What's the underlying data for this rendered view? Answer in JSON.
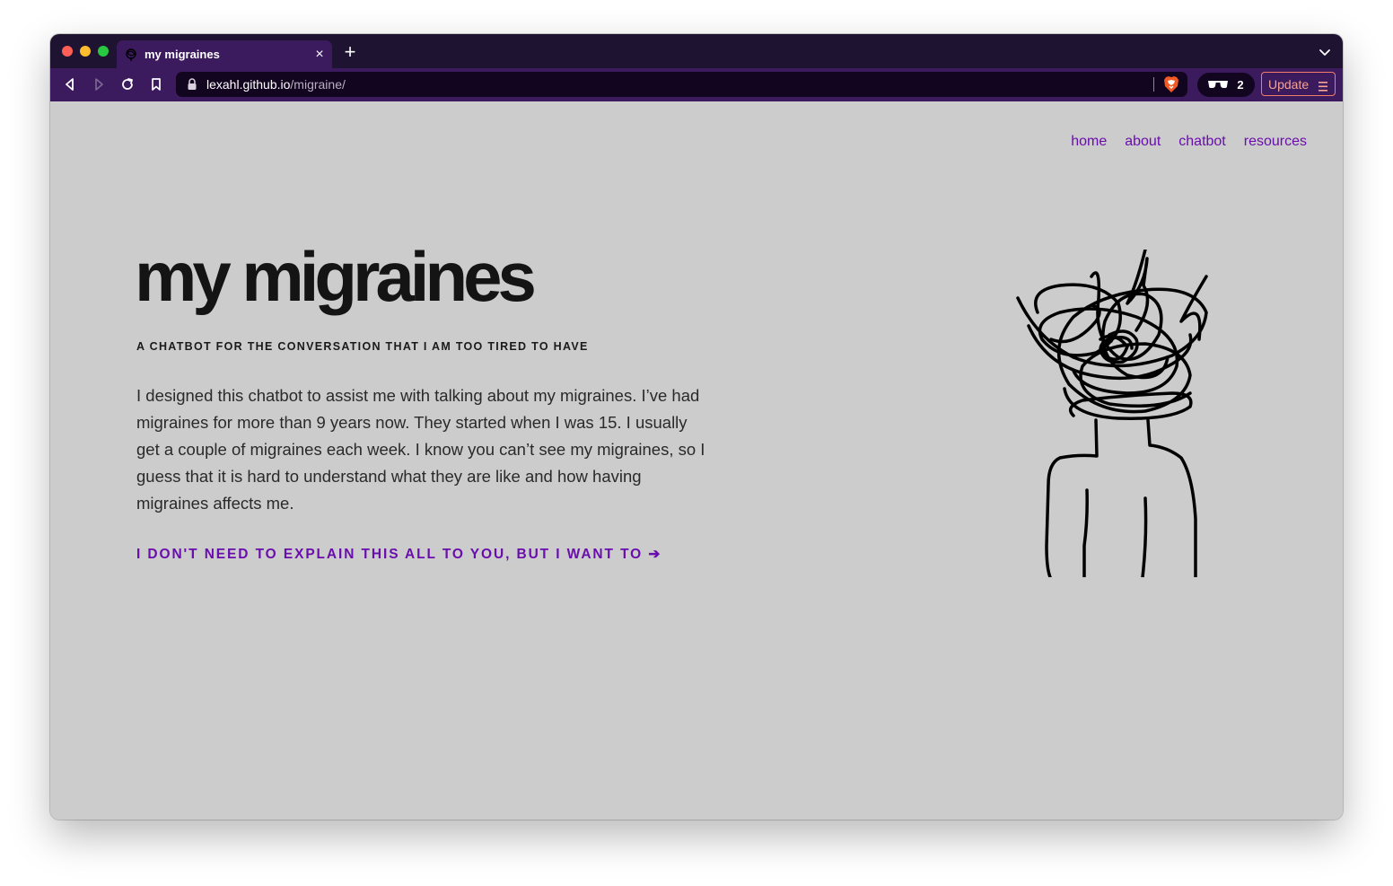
{
  "browser": {
    "tab": {
      "title": "my migraines",
      "close_glyph": "×"
    },
    "new_tab_glyph": "+",
    "address": {
      "domain": "lexahl.github.io",
      "path": "/migraine/"
    },
    "shields_count": "2",
    "update_label": "Update"
  },
  "nav": {
    "items": [
      "home",
      "about",
      "chatbot",
      "resources"
    ]
  },
  "hero": {
    "title": "my migraines",
    "subtitle": "A CHATBOT FOR THE CONVERSATION THAT I AM TOO TIRED TO HAVE",
    "intro": "I designed this chatbot to assist me with talking about my migraines. I’ve had migraines for more than 9 years now. They started when I was 15. I usually get a couple of migraines each week. I know you can’t see my migraines, so I guess that it is hard to understand what they are like and how having migraines affects me.",
    "cta": "I DON'T NEED TO EXPLAIN THIS ALL TO YOU, BUT I WANT TO ➔"
  },
  "colors": {
    "tabstrip_bg": "#1e1330",
    "toolbar_bg": "#3b1a5e",
    "page_bg": "#cccccc",
    "link": "#6a0dad",
    "update_border": "#f27b6a"
  },
  "icons": [
    "back-icon",
    "forward-icon",
    "reload-icon",
    "bookmark-icon",
    "lock-icon",
    "brave-shield-icon",
    "glasses-icon",
    "menu-icon",
    "tab-list-icon",
    "tab-favicon"
  ]
}
